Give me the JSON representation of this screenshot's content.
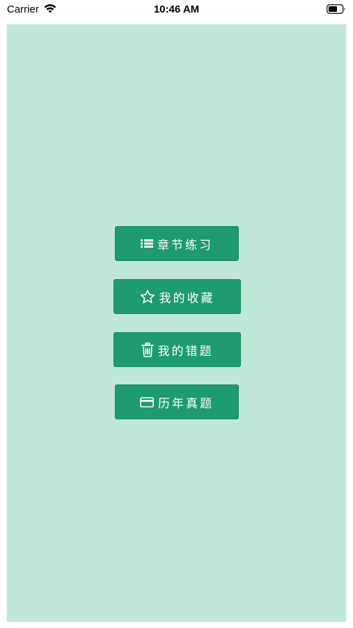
{
  "status_bar": {
    "carrier": "Carrier",
    "time": "10:46 AM"
  },
  "colors": {
    "background_panel": "#bfe8d8",
    "button": "#1e9b6f",
    "button_text": "#ffffff"
  },
  "menu": {
    "items": [
      {
        "label": "章节练习",
        "icon": "list-icon"
      },
      {
        "label": "我的收藏",
        "icon": "star-icon"
      },
      {
        "label": "我的错题",
        "icon": "trash-icon"
      },
      {
        "label": "历年真题",
        "icon": "credit-card-icon"
      }
    ]
  }
}
